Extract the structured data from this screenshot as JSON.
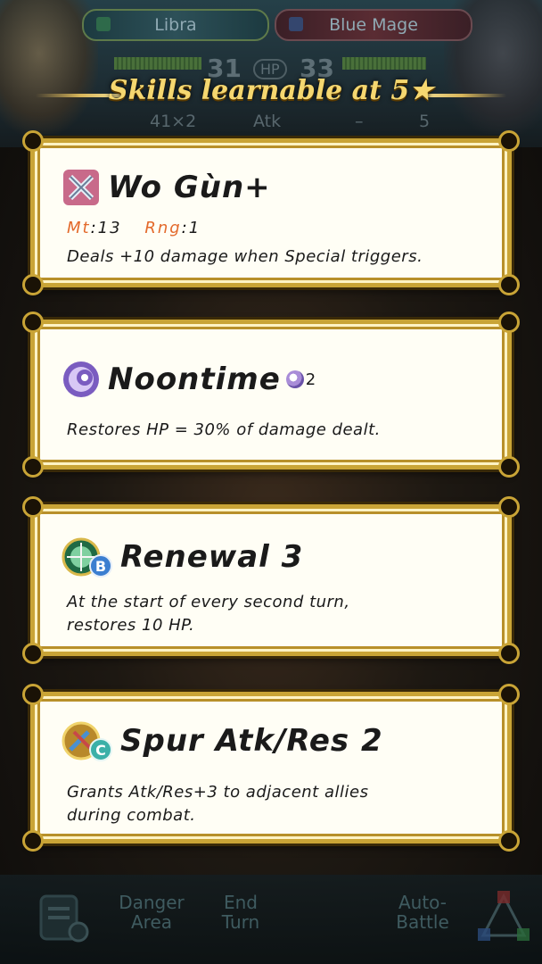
{
  "hud": {
    "unit_left": "Libra",
    "unit_right": "Blue Mage",
    "hp_label": "HP",
    "hp_left": "31",
    "hp_right": "33",
    "atk_text": "41×2",
    "atk_label": "Atk",
    "dash": "–",
    "right_num": "5"
  },
  "title": "Skills learnable at 5★",
  "skills": [
    {
      "name": "Wo Gùn+",
      "icon": "crossed-swords-icon",
      "mt_label": "Mt",
      "mt_value": "13",
      "rng_label": "Rng",
      "rng_value": "1",
      "description": "Deals +10 damage when Special triggers."
    },
    {
      "name": "Noontime",
      "icon": "special-swirl-icon",
      "cooldown": "2",
      "description": "Restores HP = 30% of damage dealt."
    },
    {
      "name": "Renewal 3",
      "icon": "passive-b-icon",
      "description_1": "At the start of every second turn,",
      "description_2": "restores 10 HP."
    },
    {
      "name": "Spur Atk/Res 2",
      "icon": "passive-c-icon",
      "description_1": "Grants Atk/Res+3 to adjacent allies",
      "description_2": "during combat."
    }
  ],
  "menu": {
    "danger_area": [
      "Danger",
      "Area"
    ],
    "end_turn": [
      "End",
      "Turn"
    ],
    "auto_battle": [
      "Auto-",
      "Battle"
    ]
  },
  "colors": {
    "gold": "#c9a436",
    "stat_label": "#e36a2c",
    "title": "#f5d770"
  }
}
